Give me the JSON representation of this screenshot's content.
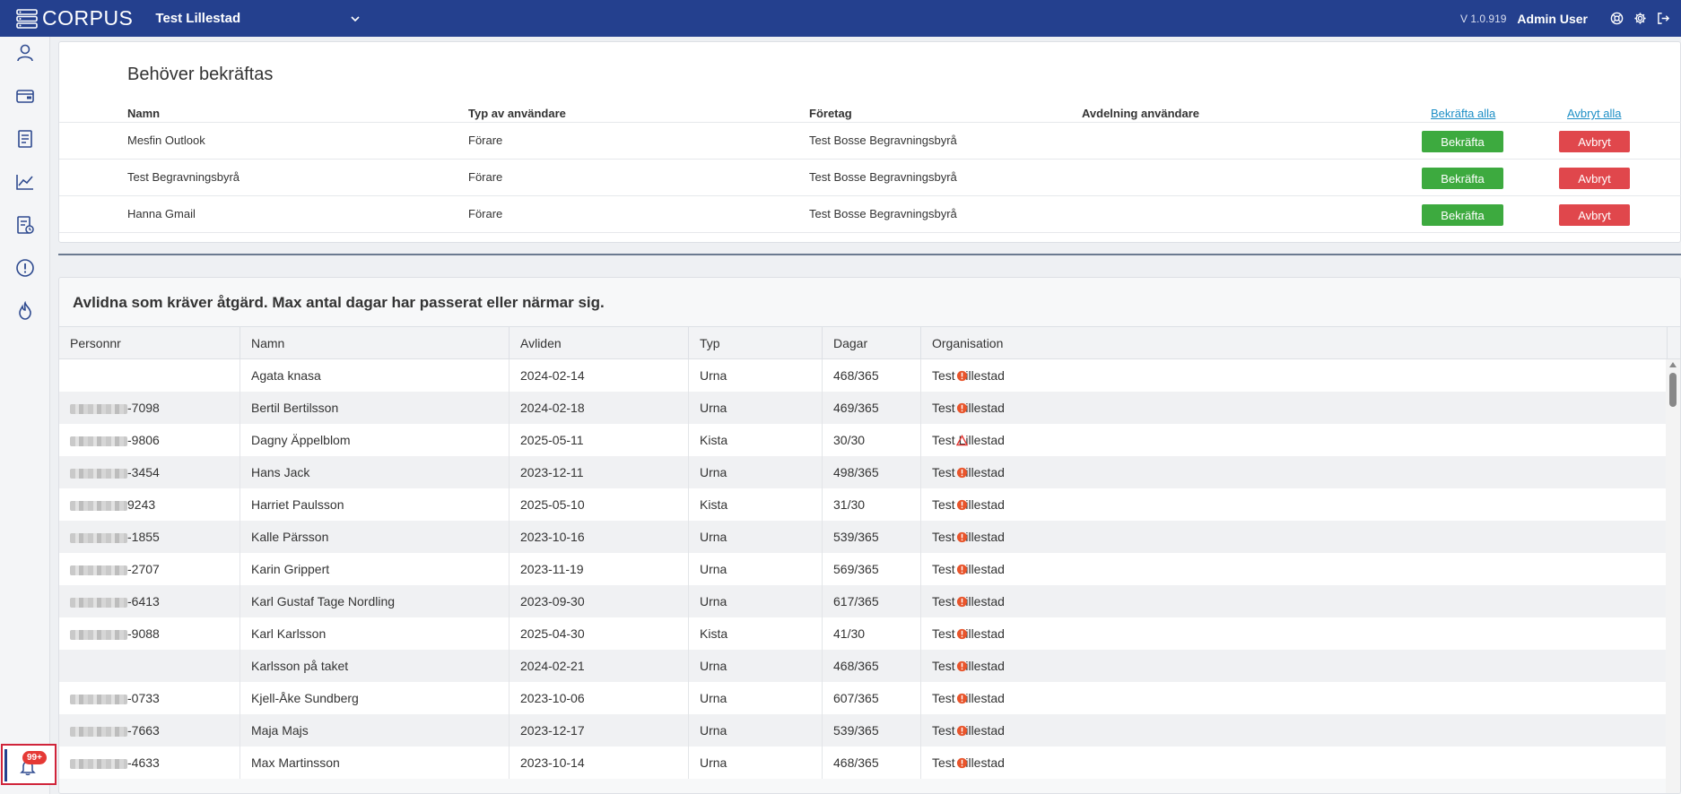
{
  "topbar": {
    "logo_text": "CORPUS",
    "org_name": "Test Lillestad",
    "version": "V 1.0.919",
    "user": "Admin User"
  },
  "sidebar": {
    "items": [
      {
        "icon": "user-icon"
      },
      {
        "icon": "wallet-icon"
      },
      {
        "icon": "invoice-icon"
      },
      {
        "icon": "chart-icon"
      },
      {
        "icon": "report-icon"
      },
      {
        "icon": "alert-icon"
      },
      {
        "icon": "flame-icon"
      }
    ],
    "notification_badge": "99+"
  },
  "confirm_card": {
    "title": "Behöver bekräftas",
    "headers": {
      "name": "Namn",
      "user_type": "Typ av användare",
      "company": "Företag",
      "department": "Avdelning användare"
    },
    "confirm_all": "Bekräfta alla",
    "cancel_all": "Avbryt alla",
    "confirm_label": "Bekräfta",
    "cancel_label": "Avbryt",
    "rows": [
      {
        "name": "Mesfin Outlook",
        "user_type": "Förare",
        "company": "Test Bosse Begravningsbyrå",
        "department": ""
      },
      {
        "name": "Test Begravningsbyrå",
        "user_type": "Förare",
        "company": "Test Bosse Begravningsbyrå",
        "department": ""
      },
      {
        "name": "Hanna Gmail",
        "user_type": "Förare",
        "company": "Test Bosse Begravningsbyrå",
        "department": ""
      }
    ]
  },
  "deceased_card": {
    "title": "Avlidna som kräver åtgärd. Max antal dagar har passerat eller närmar sig.",
    "columns": [
      "Personnr",
      "Namn",
      "Avliden",
      "Typ",
      "Dagar",
      "Organisation"
    ],
    "status_colors": {
      "overdue": "#e8552c",
      "warning": "#e53935"
    },
    "rows": [
      {
        "personnr": "",
        "masked": false,
        "name": "Agata knasa",
        "died": "2024-02-14",
        "type": "Urna",
        "days": "468/365",
        "status": "overdue",
        "org": "Test Lillestad"
      },
      {
        "personnr": "-7098",
        "masked": true,
        "name": "Bertil Bertilsson",
        "died": "2024-02-18",
        "type": "Urna",
        "days": "469/365",
        "status": "overdue",
        "org": "Test Lillestad"
      },
      {
        "personnr": "-9806",
        "masked": true,
        "name": "Dagny Äppelblom",
        "died": "2025-05-11",
        "type": "Kista",
        "days": "30/30",
        "status": "warning",
        "org": "Test Lillestad"
      },
      {
        "personnr": "-3454",
        "masked": true,
        "name": "Hans Jack",
        "died": "2023-12-11",
        "type": "Urna",
        "days": "498/365",
        "status": "overdue",
        "org": "Test Lillestad"
      },
      {
        "personnr": "9243",
        "masked": true,
        "name": "Harriet Paulsson",
        "died": "2025-05-10",
        "type": "Kista",
        "days": "31/30",
        "status": "overdue",
        "org": "Test Lillestad"
      },
      {
        "personnr": "-1855",
        "masked": true,
        "name": "Kalle Pärsson",
        "died": "2023-10-16",
        "type": "Urna",
        "days": "539/365",
        "status": "overdue",
        "org": "Test Lillestad"
      },
      {
        "personnr": "-2707",
        "masked": true,
        "name": "Karin Grippert",
        "died": "2023-11-19",
        "type": "Urna",
        "days": "569/365",
        "status": "overdue",
        "org": "Test Lillestad"
      },
      {
        "personnr": "-6413",
        "masked": true,
        "name": "Karl Gustaf Tage Nordling",
        "died": "2023-09-30",
        "type": "Urna",
        "days": "617/365",
        "status": "overdue",
        "org": "Test Lillestad"
      },
      {
        "personnr": "-9088",
        "masked": true,
        "name": "Karl Karlsson",
        "died": "2025-04-30",
        "type": "Kista",
        "days": "41/30",
        "status": "overdue",
        "org": "Test Lillestad"
      },
      {
        "personnr": "",
        "masked": false,
        "name": "Karlsson på taket",
        "died": "2024-02-21",
        "type": "Urna",
        "days": "468/365",
        "status": "overdue",
        "org": "Test Lillestad"
      },
      {
        "personnr": "-0733",
        "masked": true,
        "name": "Kjell-Åke Sundberg",
        "died": "2023-10-06",
        "type": "Urna",
        "days": "607/365",
        "status": "overdue",
        "org": "Test Lillestad"
      },
      {
        "personnr": "-7663",
        "masked": true,
        "name": "Maja Majs",
        "died": "2023-12-17",
        "type": "Urna",
        "days": "539/365",
        "status": "overdue",
        "org": "Test Lillestad"
      },
      {
        "personnr": "-4633",
        "masked": true,
        "name": "Max Martinsson",
        "died": "2023-10-14",
        "type": "Urna",
        "days": "468/365",
        "status": "overdue",
        "org": "Test Lillestad"
      }
    ]
  }
}
